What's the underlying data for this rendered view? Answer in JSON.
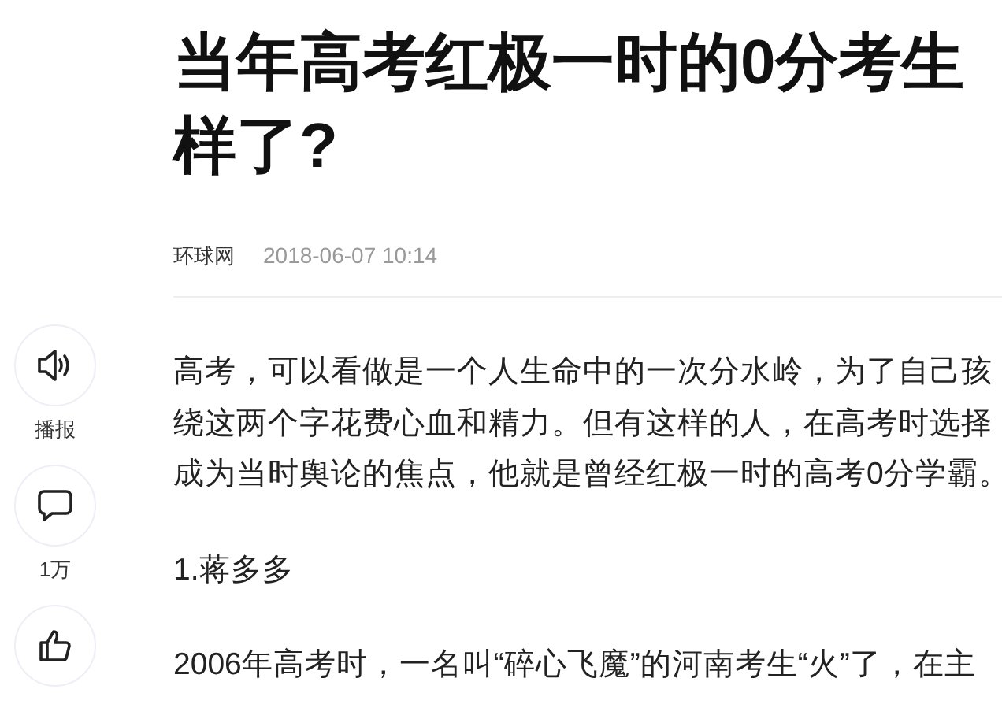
{
  "title_lines": [
    "当年高考红极一时的0分考生",
    "样了?"
  ],
  "meta": {
    "source": "环球网",
    "time": "2018-06-07 10:14"
  },
  "actions": [
    {
      "kind": "speaker",
      "label": "播报"
    },
    {
      "kind": "comment",
      "label": "1万"
    },
    {
      "kind": "like"
    }
  ],
  "body": [
    {
      "lines": [
        "高考，可以看做是一个人生命中的一次分水岭，为了自己孩",
        "绕这两个字花费心血和精力。但有这样的人，在高考时选择",
        "成为当时舆论的焦点，他就是曾经红极一时的高考0分学霸。"
      ]
    },
    {
      "lines": [
        "1.蒋多多"
      ]
    },
    {
      "lines": [
        "2006年高考时，一名叫“碎心飞魔”的河南考生“火”了，在主"
      ]
    }
  ]
}
